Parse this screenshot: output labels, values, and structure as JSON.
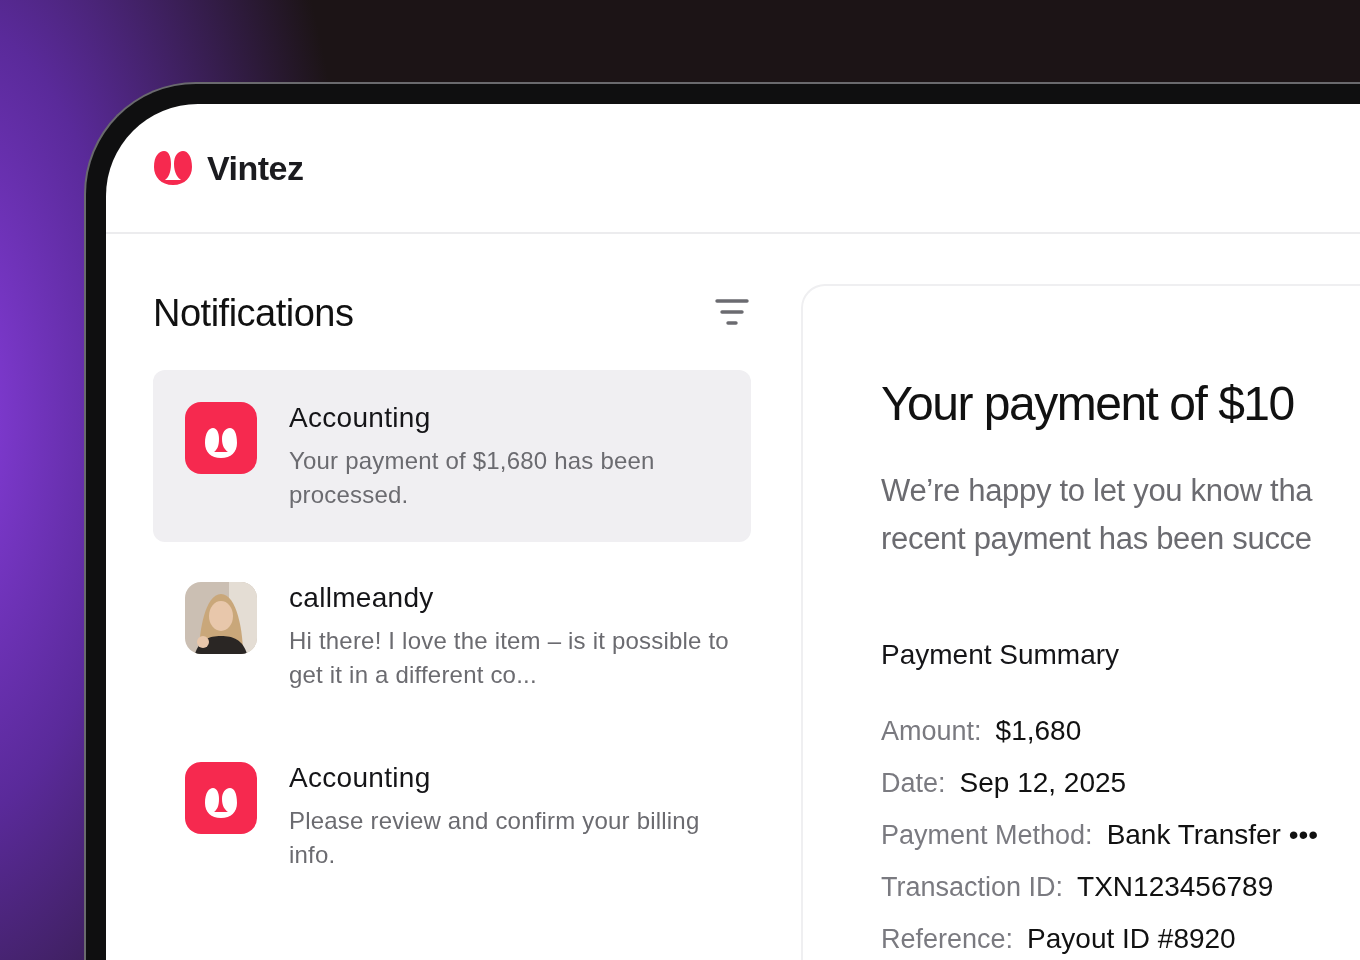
{
  "brand": {
    "name": "Vintez"
  },
  "notifications": {
    "title": "Notifications",
    "items": [
      {
        "kind": "app",
        "selected": true,
        "sender": "Accounting",
        "message": "Your payment of $1,680 has been processed."
      },
      {
        "kind": "user",
        "selected": false,
        "sender": "callmeandy",
        "message": "Hi there! I love the item – is it possible to get it in a different co..."
      },
      {
        "kind": "app",
        "selected": false,
        "sender": "Accounting",
        "message": "Please review and confirm your billing info."
      }
    ]
  },
  "detail": {
    "title": "Your payment of $10",
    "intro_lines": [
      "We’re happy to let you know tha",
      "recent payment has been succe"
    ],
    "summary_title": "Payment Summary",
    "fields": [
      {
        "label": "Amount:",
        "value": "$1,680"
      },
      {
        "label": "Date:",
        "value": "Sep 12, 2025"
      },
      {
        "label": "Payment Method:",
        "value": "Bank Transfer •••"
      },
      {
        "label": "Transaction ID:",
        "value": "TXN123456789"
      },
      {
        "label": "Reference:",
        "value": "Payout ID #8920"
      }
    ]
  }
}
